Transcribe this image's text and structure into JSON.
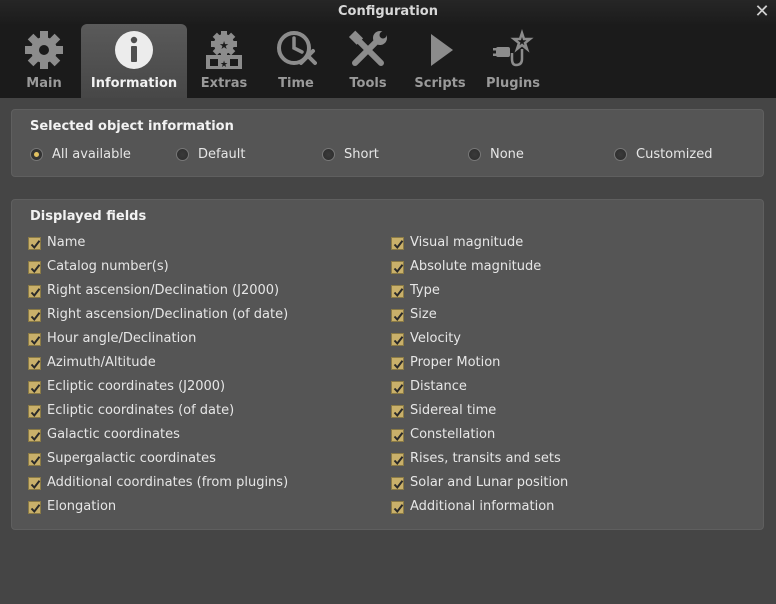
{
  "window": {
    "title": "Configuration",
    "close_glyph": "✕"
  },
  "tabs": [
    {
      "label": "Main",
      "icon": "gear-icon"
    },
    {
      "label": "Information",
      "icon": "info-icon"
    },
    {
      "label": "Extras",
      "icon": "extras-icon"
    },
    {
      "label": "Time",
      "icon": "clock-icon"
    },
    {
      "label": "Tools",
      "icon": "tools-icon"
    },
    {
      "label": "Scripts",
      "icon": "play-icon"
    },
    {
      "label": "Plugins",
      "icon": "plugin-icon"
    }
  ],
  "active_tab": "Information",
  "selected_info": {
    "title": "Selected object information",
    "options": [
      "All available",
      "Default",
      "Short",
      "None",
      "Customized"
    ],
    "selected": "All available"
  },
  "fields": {
    "title": "Displayed fields",
    "left": [
      "Name",
      "Catalog number(s)",
      "Right ascension/Declination (J2000)",
      "Right ascension/Declination (of date)",
      "Hour angle/Declination",
      "Azimuth/Altitude",
      "Ecliptic coordinates (J2000)",
      "Ecliptic coordinates (of date)",
      "Galactic coordinates",
      "Supergalactic coordinates",
      "Additional coordinates (from plugins)",
      "Elongation"
    ],
    "right": [
      "Visual magnitude",
      "Absolute magnitude",
      "Type",
      "Size",
      "Velocity",
      "Proper Motion",
      "Distance",
      "Sidereal time",
      "Constellation",
      "Rises, transits and sets",
      "Solar and Lunar position",
      "Additional information"
    ],
    "checked": true
  },
  "colors": {
    "accent": "#c9b06a",
    "background": "#454545",
    "toolbar": "#1b1b1b"
  }
}
